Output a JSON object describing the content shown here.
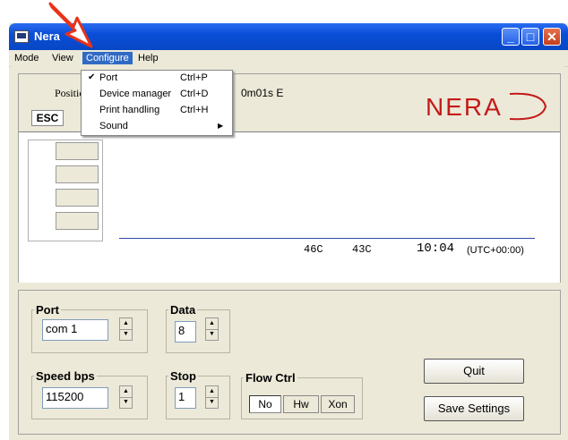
{
  "window": {
    "title": "Nera"
  },
  "menubar": {
    "items": [
      "Mode",
      "View",
      "Configure",
      "Help"
    ]
  },
  "configure_menu": {
    "items": [
      {
        "label": "Port",
        "shortcut": "Ctrl+P",
        "checked": true
      },
      {
        "label": "Device manager",
        "shortcut": "Ctrl+D"
      },
      {
        "label": "Print handling",
        "shortcut": "Ctrl+H"
      },
      {
        "label": "Sound",
        "submenu": true
      }
    ]
  },
  "header": {
    "position_label": "Position",
    "position_value": "0m01s E",
    "esc_label": "ESC",
    "logo_text": "NERA"
  },
  "status": {
    "temp1": "46C",
    "temp2": "43C",
    "time": "10:04",
    "timezone": "(UTC+00:00)"
  },
  "settings": {
    "port": {
      "label": "Port",
      "value": "com 1"
    },
    "data": {
      "label": "Data",
      "value": "8"
    },
    "speed": {
      "label": "Speed bps",
      "value": "115200"
    },
    "stop": {
      "label": "Stop",
      "value": "1"
    },
    "flow": {
      "label": "Flow Ctrl",
      "options": [
        "No",
        "Hw",
        "Xon"
      ],
      "selected": "No"
    }
  },
  "buttons": {
    "quit": "Quit",
    "save": "Save Settings"
  },
  "colors": {
    "titlebar": "#0a4ed8",
    "menu_highlight": "#316ac5",
    "arrow": "#e8321a",
    "logo": "#c41a1a"
  }
}
